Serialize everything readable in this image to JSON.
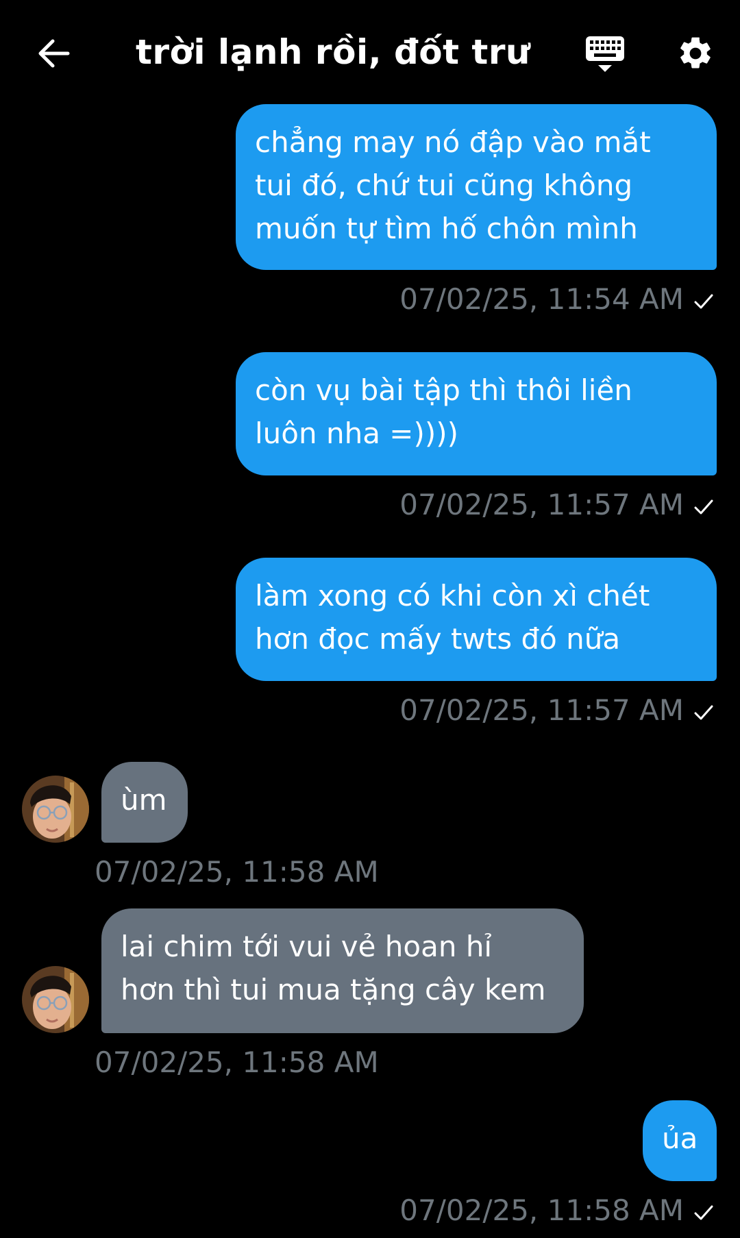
{
  "header": {
    "title": "trời lạnh rồi, đốt trư...",
    "back_icon": "arrow-left-icon",
    "keyboard_icon": "keyboard-icon",
    "settings_icon": "gear-icon"
  },
  "colors": {
    "background": "#000000",
    "outgoing_bubble": "#1d9bf0",
    "incoming_bubble": "#67727e",
    "timestamp": "#6e767d"
  },
  "messages": [
    {
      "direction": "outgoing",
      "lines": [
        "chẳng may nó đập vào mắt",
        "tui đó, chứ tui cũng không",
        "muốn tự tìm hố chôn mình"
      ],
      "timestamp": "07/02/25, 11:54 AM",
      "status_icon": "check-icon"
    },
    {
      "direction": "outgoing",
      "lines": [
        "còn vụ bài tập thì thôi liền",
        "luôn nha =))))"
      ],
      "timestamp": "07/02/25, 11:57 AM",
      "status_icon": "check-icon"
    },
    {
      "direction": "outgoing",
      "lines": [
        "làm xong có khi còn xì chét",
        "hơn đọc mấy twts đó nữa"
      ],
      "timestamp": "07/02/25, 11:57 AM",
      "status_icon": "check-icon"
    },
    {
      "direction": "incoming",
      "lines": [
        "ùm"
      ],
      "timestamp": "07/02/25, 11:58 AM"
    },
    {
      "direction": "incoming",
      "lines": [
        "lai chim tới vui vẻ hoan hỉ",
        "hơn thì tui mua tặng cây kem"
      ],
      "timestamp": "07/02/25, 11:58 AM"
    },
    {
      "direction": "outgoing",
      "lines": [
        "ủa"
      ],
      "timestamp": "07/02/25, 11:58 AM",
      "status_icon": "check-icon"
    }
  ]
}
